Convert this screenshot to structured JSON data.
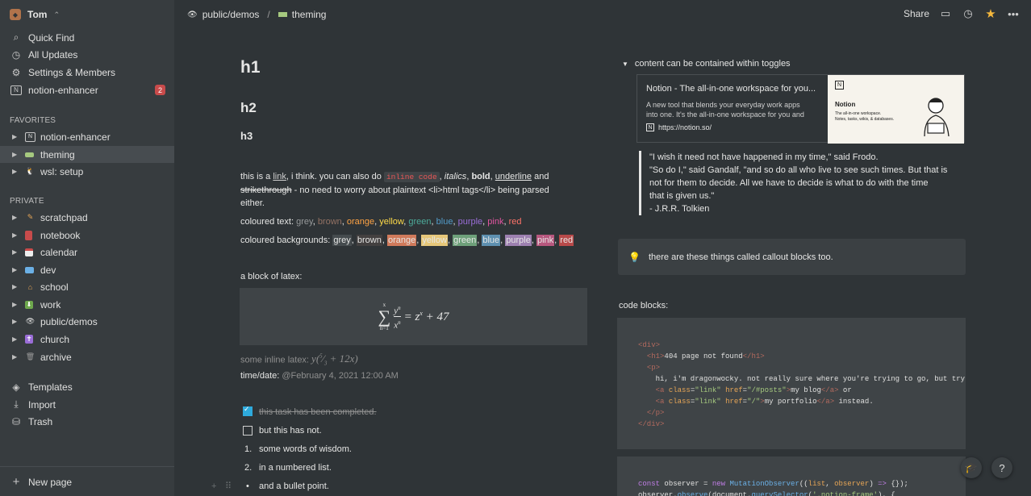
{
  "sidebar": {
    "workspace": "Tom",
    "nav": [
      {
        "label": "Quick Find",
        "icon": "search-icon"
      },
      {
        "label": "All Updates",
        "icon": "clock-icon"
      },
      {
        "label": "Settings & Members",
        "icon": "gear-icon"
      },
      {
        "label": "notion-enhancer",
        "icon": "notion-icon",
        "badge": "2"
      }
    ],
    "favorites_title": "FAVORITES",
    "favorites": [
      {
        "label": "notion-enhancer"
      },
      {
        "label": "theming"
      },
      {
        "label": "wsl: setup"
      }
    ],
    "private_title": "PRIVATE",
    "private": [
      {
        "label": "scratchpad"
      },
      {
        "label": "notebook"
      },
      {
        "label": "calendar"
      },
      {
        "label": "dev"
      },
      {
        "label": "school"
      },
      {
        "label": "work"
      },
      {
        "label": "public/demos"
      },
      {
        "label": "church"
      },
      {
        "label": "archive"
      }
    ],
    "footer": [
      {
        "label": "Templates"
      },
      {
        "label": "Import"
      },
      {
        "label": "Trash"
      }
    ],
    "new_page": "New page"
  },
  "topbar": {
    "crumb1": "public/demos",
    "sep": "/",
    "crumb2": "theming",
    "share": "Share"
  },
  "content": {
    "h1": "h1",
    "h2": "h2",
    "h3": "h3",
    "para_a": "this is a ",
    "link": "link",
    "para_b": ", i think. you can also do ",
    "inline_code": "inline code",
    "para_c": ", ",
    "italics": "italics",
    "bold": "bold",
    "underline": "underline",
    "and": " and",
    "strike": "strikethrough",
    "para_d": " - no need to worry about plaintext <li>html tags</li> being parsed",
    "para_e": "either.",
    "coloured_text_label": "coloured text: ",
    "colours": [
      "grey",
      "brown",
      "orange",
      "yellow",
      "green",
      "blue",
      "purple",
      "pink",
      "red"
    ],
    "coloured_bg_label": "coloured backgrounds: ",
    "latex_label": "a block of latex:",
    "inline_latex_label": "some inline latex: ",
    "time_label": "time/date: ",
    "date": "@February 4, 2021 12:00 AM",
    "todo_done": "this task has been completed.",
    "todo_open": "but this has not.",
    "num1": "some words of wisdom.",
    "num2": "in a numbered list.",
    "bullet": "and a bullet point.",
    "n1": "1.",
    "n2": "2."
  },
  "right": {
    "toggle": "content can be contained within toggles",
    "bm_title": "Notion - The all-in-one workspace for you...",
    "bm_desc1": "A new tool that blends your everyday work apps",
    "bm_desc2": "into one. It's the all-in-one workspace for you and",
    "bm_url": "https://notion.so/",
    "bm_img_title": "Notion",
    "bm_img_sub1": "The all-in-one workspace.",
    "bm_img_sub2": "Notes, tasks, wikis, & databases.",
    "quote": [
      "\"I wish it need not have happened in my time,\" said Frodo.",
      "\"So do I,\" said Gandalf, \"and so do all who live to see such times. But that is",
      "not for them to decide. All we have to decide is what to do with the time",
      "that is given us.\"",
      "- J.R.R. Tolkien"
    ],
    "callout": "there are these things called callout blocks too.",
    "code_label": "code blocks:"
  },
  "colors": {
    "grey": "#979a9b",
    "brown": "#937264",
    "orange": "#ffa344",
    "yellow": "#ffdc49",
    "green": "#4dab9a",
    "blue": "#529cca",
    "purple": "#9a6dd7",
    "pink": "#e255a1",
    "red": "#ff7369"
  }
}
